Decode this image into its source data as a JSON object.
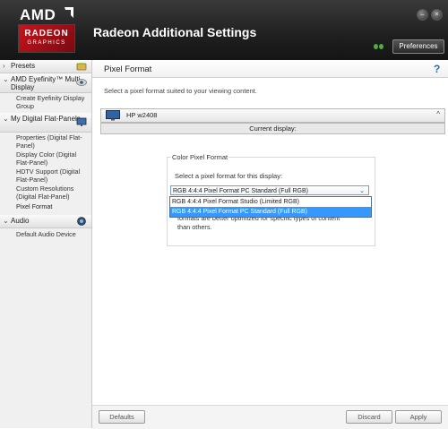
{
  "header": {
    "logo_brand": "AMD",
    "logo_line1": "RADEON",
    "logo_line2": "GRAPHICS",
    "title": "Radeon Additional Settings",
    "minimize_glyph": "–",
    "close_glyph": "×",
    "preferences_label": "Preferences"
  },
  "sidebar": {
    "presets": "Presets",
    "eyefinity": "AMD Eyefinity™ Multi-Display",
    "eyefinity_items": [
      "Create Eyefinity Display Group"
    ],
    "flat_panels": "My Digital Flat-Panels",
    "flat_panel_items": [
      "Properties (Digital Flat-Panel)",
      "Display Color (Digital Flat-Panel)",
      "HDTV Support (Digital Flat-Panel)",
      "Custom Resolutions (Digital Flat-Panel)",
      "Pixel Format"
    ],
    "audio": "Audio",
    "audio_items": [
      "Default Audio Device"
    ]
  },
  "main": {
    "page_title": "Pixel Format",
    "help_glyph": "?",
    "description": "Select a pixel format suited to your viewing content.",
    "display_name": "HP w2408",
    "display_chevron": "^",
    "current_display_label": "Current display:",
    "group_title": "Color Pixel Format",
    "group_prompt": "Select a pixel format for this display:",
    "selected_format": "RGB 4:4:4 Pixel Format PC Standard (Full RGB)",
    "select_arrow": "⌄",
    "format_options": [
      "RGB 4:4:4 Pixel Format Studio (Limited RGB)",
      "RGB 4:4:4 Pixel Format PC Standard (Full RGB)"
    ],
    "description_behind_line1": "formats are better optimized for specific types of content",
    "description_behind_line2": "than others."
  },
  "footer": {
    "defaults": "Defaults",
    "discard": "Discard",
    "apply": "Apply"
  },
  "colors": {
    "accent": "#3399ff",
    "brand_red": "#c8141d",
    "status_green": "#4caf3a"
  }
}
